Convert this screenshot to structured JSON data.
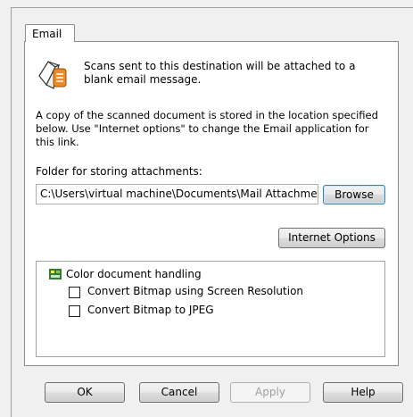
{
  "tab": {
    "label": "Email"
  },
  "intro": {
    "text": "Scans sent to this destination will be attached to a blank email message."
  },
  "description": {
    "text": "A copy of the scanned document is stored in the location specified below. Use \"Internet options\" to change the Email application for this link."
  },
  "folder": {
    "label": "Folder for storing attachments:",
    "path_value": "C:\\Users\\virtual machine\\Documents\\Mail Attachments",
    "browse_label": "Browse"
  },
  "internet_options_label": "Internet Options",
  "document_handling": {
    "group_label": "Color document handling",
    "options": [
      {
        "label": "Convert Bitmap using Screen Resolution",
        "checked": false
      },
      {
        "label": "Convert Bitmap to JPEG",
        "checked": false
      }
    ]
  },
  "buttons": {
    "ok": "OK",
    "cancel": "Cancel",
    "apply": "Apply",
    "help": "Help"
  },
  "icons": {
    "email": "email-icon",
    "tree": "color-document-icon"
  },
  "colors": {
    "panel_border": "#898c95",
    "background": "#f0f0f0",
    "disabled_text": "#a0a0a0"
  }
}
